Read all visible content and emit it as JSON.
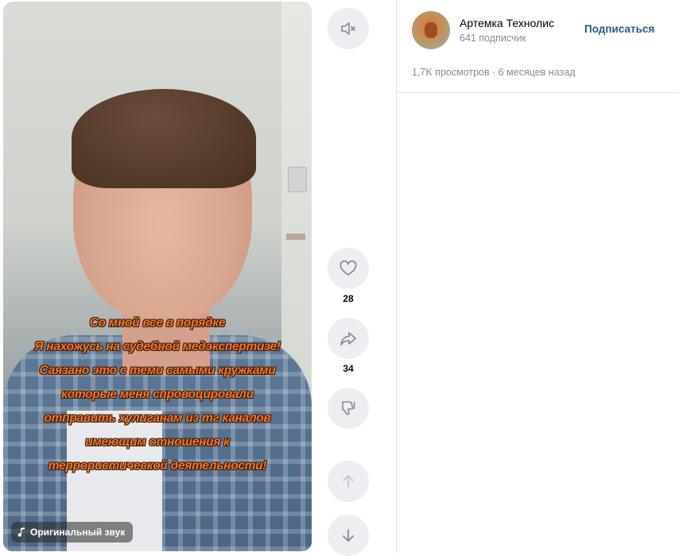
{
  "video": {
    "caption_lines": [
      "Со мной все в порядке",
      "Я нахожусь на судебной медэкспертизе!",
      "Саязано это с теми самыми кружками",
      "которые меня спровоцировали",
      "отправить хулиганам из тг каналов",
      "имеющим отношения к",
      "террористической деятельности!"
    ],
    "sound_label": "Оригинальный звук"
  },
  "actions": {
    "mute_icon": "muted-speaker-icon",
    "like_icon": "heart-icon",
    "like_count": "28",
    "share_icon": "share-arrow-icon",
    "share_count": "34",
    "dislike_icon": "thumbs-down-icon",
    "prev_icon": "arrow-up-icon",
    "next_icon": "arrow-down-icon"
  },
  "author": {
    "name": "Артемка Технолис",
    "subscribers": "641 подписчик",
    "subscribe_label": "Подписаться"
  },
  "stats": {
    "views_and_date": "1,7K просмотров · 6 месяцев назад"
  },
  "colors": {
    "caption": "#f0772a",
    "link": "#2a5885",
    "muted_text": "#818c99",
    "button_bg": "#eceef1"
  }
}
